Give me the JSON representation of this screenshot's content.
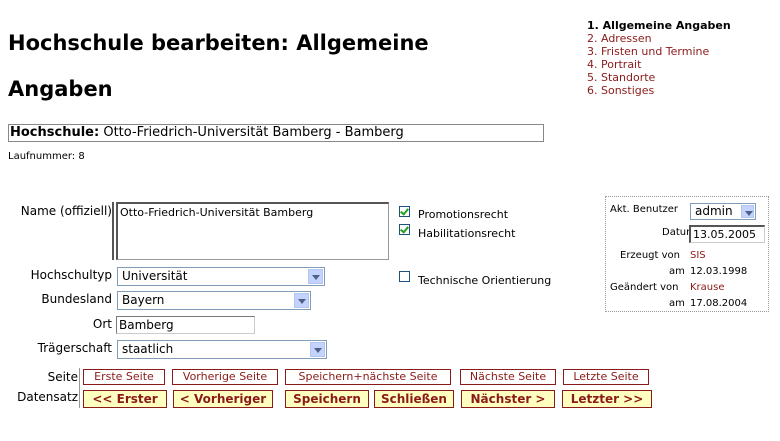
{
  "page": {
    "title_line1": "Hochschule bearbeiten: Allgemeine",
    "title_line2": "Angaben"
  },
  "steps": [
    {
      "label": "1. Allgemeine Angaben",
      "active": true
    },
    {
      "label": "2. Adressen"
    },
    {
      "label": "3. Fristen und Termine"
    },
    {
      "label": "4. Portrait"
    },
    {
      "label": "5. Standorte"
    },
    {
      "label": "6. Sonstiges"
    }
  ],
  "hochschule": {
    "label": "Hochschule:",
    "value": "Otto-Friedrich-Universität Bamberg - Bamberg"
  },
  "laufnummer": "Laufnummer: 8",
  "form": {
    "name_label": "Name (offiziell)",
    "name_value": "Otto-Friedrich-Universität Bamberg",
    "hochschultyp_label": "Hochschultyp",
    "hochschultyp_value": "Universität",
    "bundesland_label": "Bundesland",
    "bundesland_value": "Bayern",
    "ort_label": "Ort",
    "ort_value": "Bamberg",
    "traegerschaft_label": "Trägerschaft",
    "traegerschaft_value": "staatlich"
  },
  "checkboxes": {
    "promotionsrecht": {
      "label": "Promotionsrecht",
      "checked": true
    },
    "habilitationsrecht": {
      "label": "Habilitationsrecht",
      "checked": true
    },
    "technische": {
      "label": "Technische Orientierung",
      "checked": false
    }
  },
  "info": {
    "benutzer_label": "Akt. Benutzer",
    "benutzer_value": "admin",
    "datum_label": "Datum",
    "datum_value": "13.05.2005",
    "erzeugt_label": "Erzeugt von",
    "erzeugt_user": "SIS",
    "erzeugt_am_label": "am",
    "erzeugt_am": "12.03.1998",
    "geaendert_label": "Geändert von",
    "geaendert_user": "Krause",
    "geaendert_am_label": "am",
    "geaendert_am": "17.08.2004"
  },
  "nav": {
    "seite_label": "Seite",
    "datensatz_label": "Datensatz",
    "seite_buttons": [
      "Erste Seite",
      "Vorherige Seite",
      "Speichern+nächste Seite",
      "Nächste Seite",
      "Letzte Seite"
    ],
    "datensatz_buttons": [
      "<< Erster",
      "< Vorheriger",
      "Speichern",
      "Schließen",
      "Nächster >",
      "Letzter >>"
    ]
  },
  "colors": {
    "link": "#8b1a1a",
    "button_bg": "#ffffc0"
  }
}
